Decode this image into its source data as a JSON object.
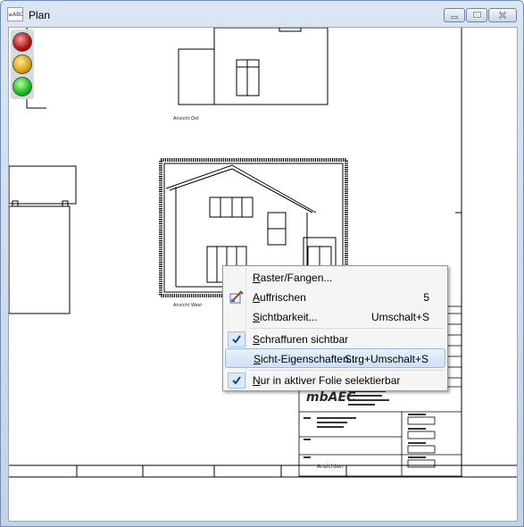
{
  "window": {
    "title": "Plan",
    "app_icon_text": "≡ABC",
    "controls": {
      "minimize": "minimize",
      "maximize": "maximize",
      "close": "close"
    }
  },
  "plan": {
    "labels": {
      "view_top": "Ansicht Ost",
      "view_center": "Ansicht West",
      "titleblock_view": "Ansichten",
      "logo": "mbAEC"
    }
  },
  "traffic_light": {
    "states": [
      "red",
      "yellow",
      "green"
    ],
    "active": "green"
  },
  "context_menu": {
    "items": [
      {
        "label": "Raster/Fangen...",
        "accel": "R",
        "shortcut": "",
        "icon": "",
        "checked": false,
        "highlighted": false
      },
      {
        "label": "Auffrischen",
        "accel": "A",
        "shortcut": "5",
        "icon": "refresh-brush-icon",
        "checked": false,
        "highlighted": false
      },
      {
        "label": "Sichtbarkeit...",
        "accel": "S",
        "shortcut": "Umschalt+S",
        "icon": "",
        "checked": false,
        "highlighted": false
      },
      {
        "label": "Schraffuren sichtbar",
        "accel": "S",
        "shortcut": "",
        "icon": "check-icon",
        "checked": true,
        "highlighted": false
      },
      {
        "label": "Sicht-Eigenschaften...",
        "accel": "S",
        "shortcut": "Strg+Umschalt+S",
        "icon": "",
        "checked": false,
        "highlighted": true
      },
      {
        "label": "Nur in aktiver Folie selektierbar",
        "accel": "N",
        "shortcut": "",
        "icon": "check-icon",
        "checked": true,
        "highlighted": false
      }
    ]
  }
}
